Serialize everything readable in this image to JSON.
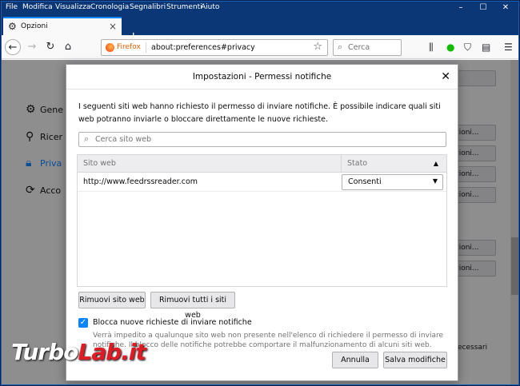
{
  "menu": [
    "File",
    "Modifica",
    "Visualizza",
    "Cronologia",
    "Segnalibri",
    "Strumenti",
    "Aiuto"
  ],
  "tab": {
    "label": "Opzioni"
  },
  "urlbar": {
    "identity": "Firefox",
    "url": "about:preferences#privacy"
  },
  "searchbar": {
    "placeholder": "Cerca"
  },
  "background": {
    "categories": [
      "Gene",
      "Ricer",
      "Priva",
      "Acco"
    ],
    "buttons": [
      "zioni...",
      "zioni...",
      "zioni...",
      "zioni...",
      "zioni...",
      "zioni..."
    ],
    "right_text": "ecessari"
  },
  "dialog": {
    "title": "Impostazioni - Permessi notifiche",
    "description": "I seguenti siti web hanno richiesto il permesso di inviare notifiche. È possibile indicare quali siti web potranno inviarle o bloccare direttamente le nuove richieste.",
    "search_placeholder": "Cerca sito web",
    "columns": {
      "site": "Sito web",
      "status": "Stato"
    },
    "rows": [
      {
        "site": "http://www.feedrssreader.com",
        "status": "Consenti"
      }
    ],
    "buttons": {
      "remove": "Rimuovi sito web",
      "remove_all": "Rimuovi tutti i siti web",
      "cancel": "Annulla",
      "save": "Salva modifiche"
    },
    "block_checkbox": {
      "label": "Blocca nuove richieste di inviare notifiche",
      "checked": true
    },
    "note": "Verrà impedito a qualunque sito web non presente nell'elenco di richiedere il permesso di inviare notifiche. Il blocco delle notifiche potrebbe comportare il malfunzionamento di alcuni siti web."
  },
  "watermark": {
    "part1": "Turbo",
    "part2": "Lab.it"
  },
  "colors": {
    "titlebar": "#0c3777",
    "accent": "#0a84ff"
  }
}
